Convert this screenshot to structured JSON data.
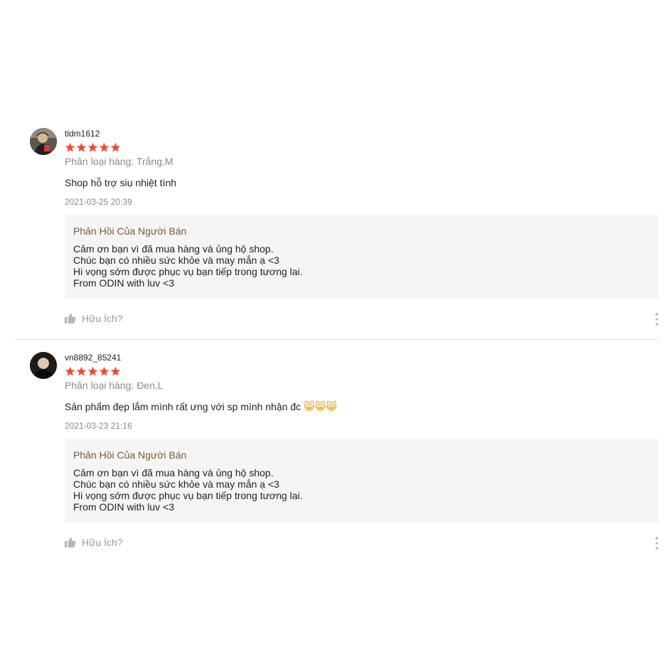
{
  "colors": {
    "star": "#ee4d2d",
    "reply_title": "#7a5a3a",
    "reply_bg": "#f5f5f5",
    "muted": "#8a8a8a"
  },
  "reviews": [
    {
      "username": "tldm1612",
      "rating": 5,
      "variant": "Phân loại hàng: Trắng,M",
      "comment": "Shop hỗ trợ siu nhiệt tình",
      "emojis": [],
      "timestamp": "2021-03-25 20:39",
      "seller_reply": {
        "title": "Phản Hồi Của Người Bán",
        "lines": [
          "Cảm ơn bạn vì đã mua hàng và ủng hộ shop.",
          "Chúc bạn có nhiều sức khỏe và may mắn ạ <3",
          "Hi vọng sớm được phục vụ bạn tiếp trong tương lai.",
          "From ODIN with luv <3"
        ]
      },
      "helpful_label": "Hữu Ích?",
      "icons": {
        "helpful": "thumbs-up-icon",
        "more": "more-vertical-icon"
      }
    },
    {
      "username": "vn8892_85241",
      "rating": 5,
      "variant": "Phân loại hàng: Đen,L",
      "comment": "Sản phẩm đẹp lắm mình rất ưng với sp mình nhận đc",
      "emojis": [
        "😸",
        "😸",
        "😸"
      ],
      "timestamp": "2021-03-23 21:16",
      "seller_reply": {
        "title": "Phản Hồi Của Người Bán",
        "lines": [
          "Cảm ơn bạn vì đã mua hàng và ủng hộ shop.",
          "Chúc bạn có nhiều sức khỏe và may mắn ạ <3",
          "Hi vọng sớm được phục vụ bạn tiếp trong tương lai.",
          "From ODIN with luv <3"
        ]
      },
      "helpful_label": "Hữu Ích?",
      "icons": {
        "helpful": "thumbs-up-icon",
        "more": "more-vertical-icon"
      }
    }
  ]
}
